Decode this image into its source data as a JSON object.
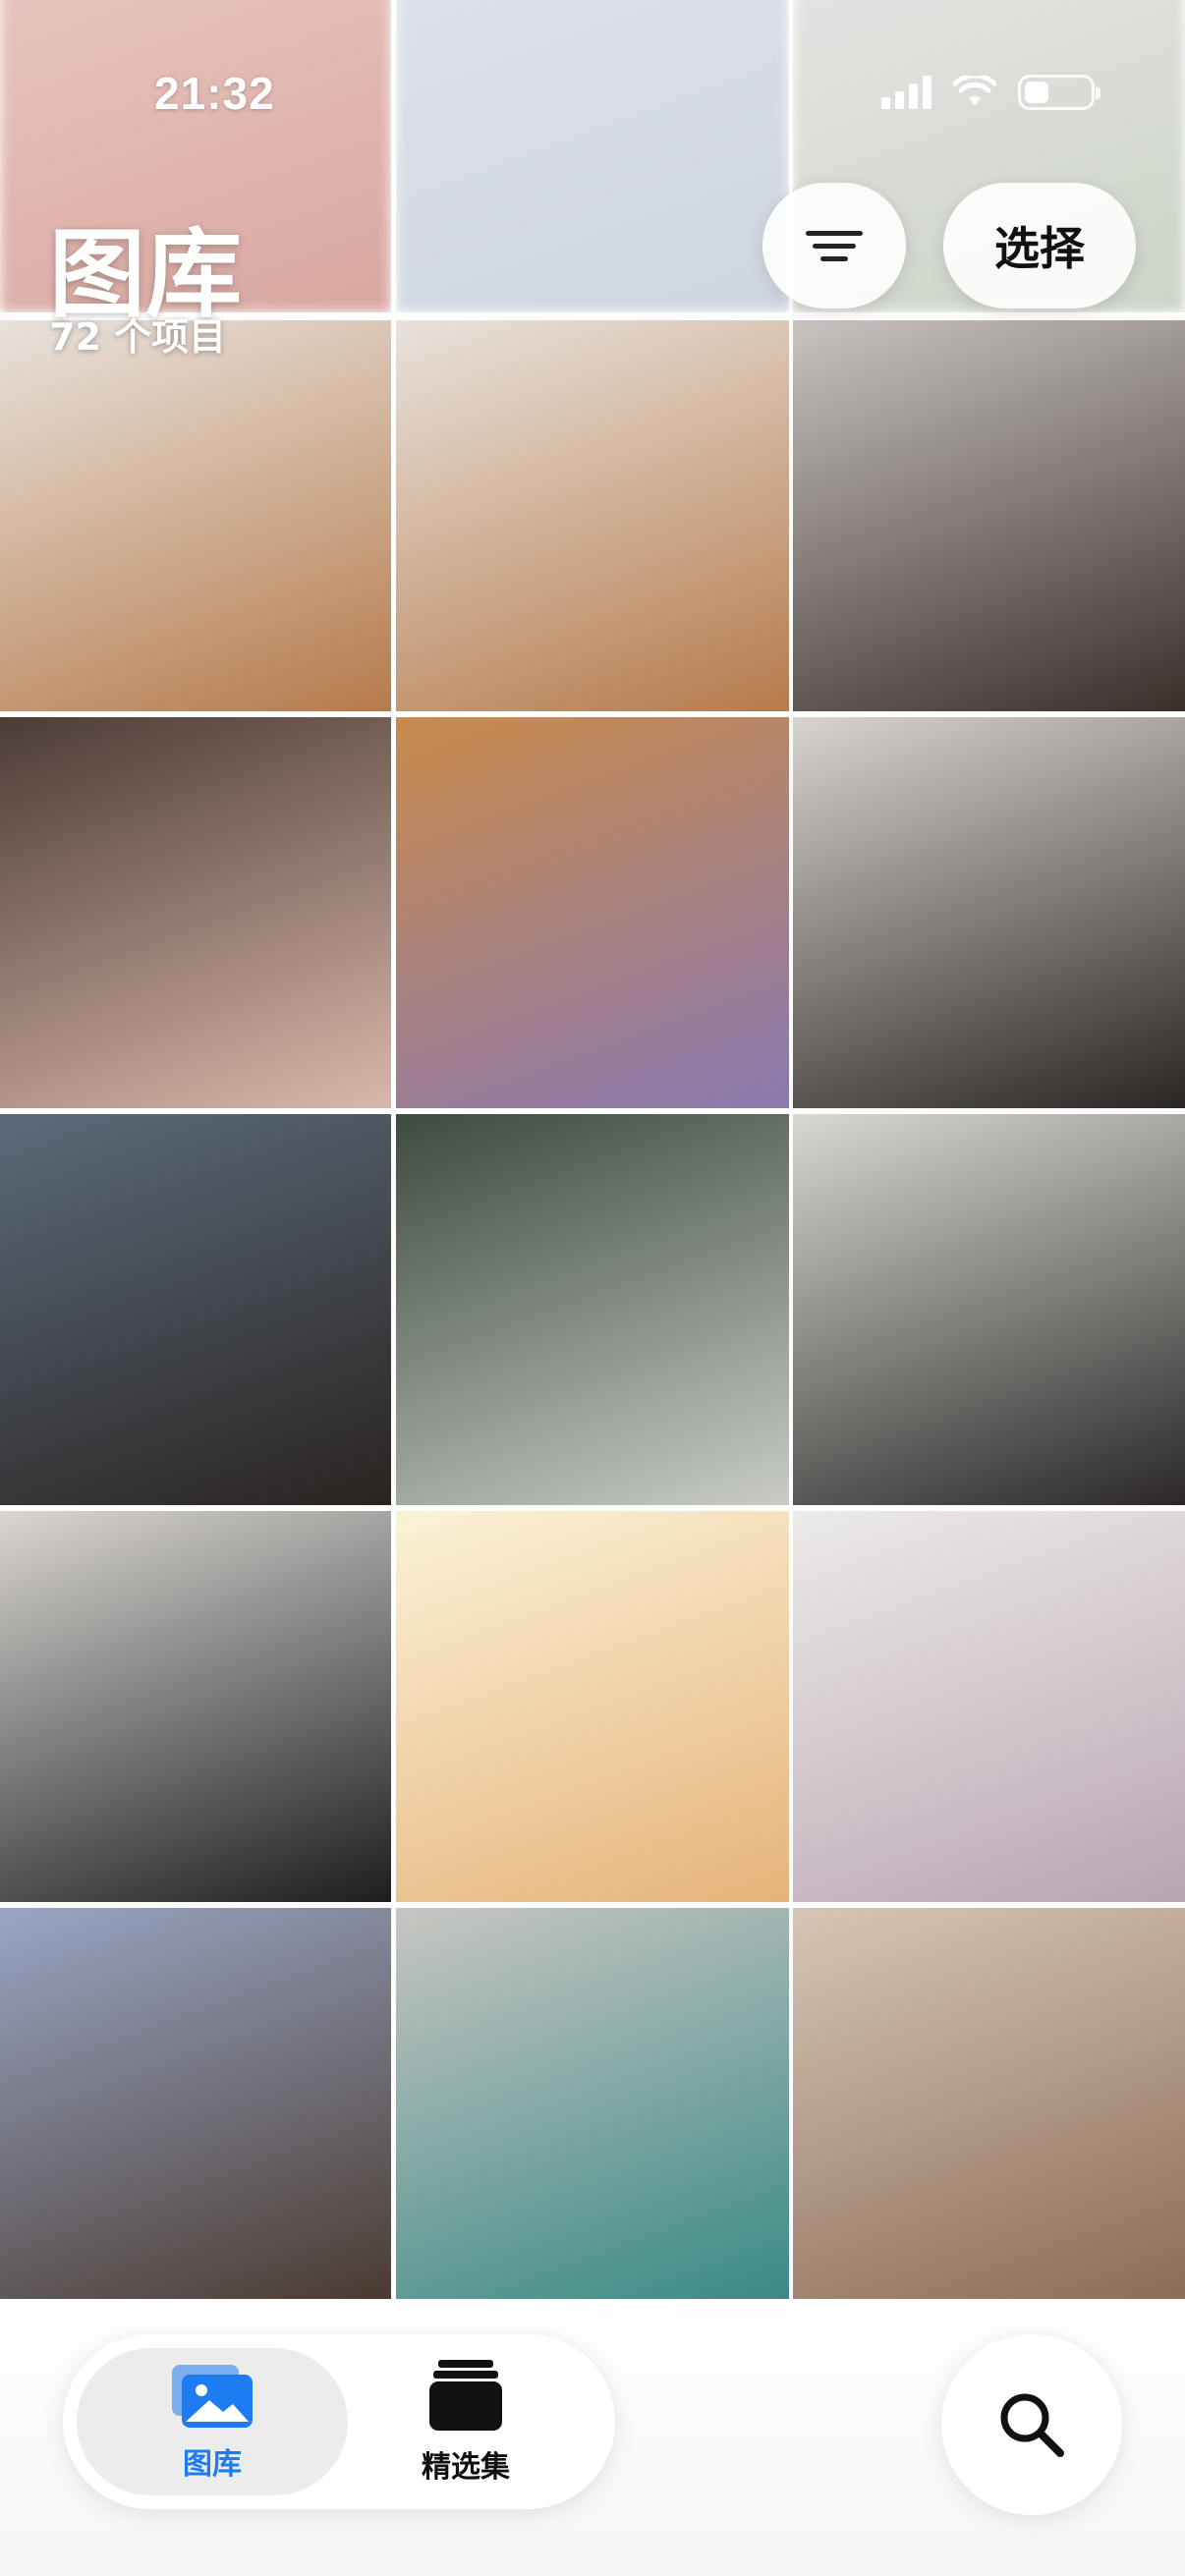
{
  "status": {
    "time": "21:32"
  },
  "header": {
    "title": "图库",
    "count_label": "72 个项目",
    "filter_icon": "filter-lines-icon",
    "select_label": "选择"
  },
  "photos": [
    {
      "name": "recent-blurred-baby",
      "colors": [
        "#e9c9c2",
        "#d9a7a0"
      ]
    },
    {
      "name": "recent-blurred-screenshot-chat",
      "colors": [
        "#dfe3ea",
        "#cfd6e0"
      ]
    },
    {
      "name": "recent-blurred-screenshot-chat-2",
      "colors": [
        "#e7e7e7",
        "#cdd4c7"
      ]
    },
    {
      "name": "food-platter-pizza-1",
      "colors": [
        "#e9e3dd",
        "#b67b4c"
      ]
    },
    {
      "name": "food-platter-pizza-2",
      "colors": [
        "#e9e3dd",
        "#b67b4c"
      ]
    },
    {
      "name": "girl-selfie-long-hair",
      "colors": [
        "#c9c4c1",
        "#3a2f2b"
      ]
    },
    {
      "name": "girl-in-car-seat",
      "colors": [
        "#4c3b36",
        "#d9b8a9"
      ]
    },
    {
      "name": "girl-supreme-cap-icecream",
      "colors": [
        "#c98b4b",
        "#8a79b0"
      ]
    },
    {
      "name": "girl-striped-shirt",
      "colors": [
        "#d9d4d0",
        "#2b2623"
      ]
    },
    {
      "name": "girl-eating-skewer",
      "colors": [
        "#5b6b7b",
        "#2a2320"
      ]
    },
    {
      "name": "girl-striped-shirt-street",
      "colors": [
        "#3d4a3e",
        "#c8ccc5"
      ]
    },
    {
      "name": "girl-mirror-selfie-station",
      "colors": [
        "#d7d9d3",
        "#2b2827"
      ]
    },
    {
      "name": "girl-black-coat",
      "colors": [
        "#d9d6d3",
        "#1e1d1d"
      ]
    },
    {
      "name": "anime-girl-sticker",
      "colors": [
        "#fbf3d7",
        "#e6b27a"
      ]
    },
    {
      "name": "bunny-figure-flower",
      "colors": [
        "#ecebe8",
        "#b9a5b3"
      ]
    },
    {
      "name": "girl-winter-hat-beach",
      "colors": [
        "#9aa6c5",
        "#4a3b31"
      ]
    },
    {
      "name": "girl-teal-striped-shirt",
      "colors": [
        "#c8c6c2",
        "#3a8a86"
      ]
    },
    {
      "name": "cat-with-juice-box",
      "colors": [
        "#d7c6b5",
        "#8b6d57"
      ]
    }
  ],
  "tabbar": {
    "library_label": "图库",
    "library_icon": "photos-library-icon",
    "collections_label": "精选集",
    "collections_icon": "collections-stack-icon"
  },
  "search_icon": "search-icon"
}
